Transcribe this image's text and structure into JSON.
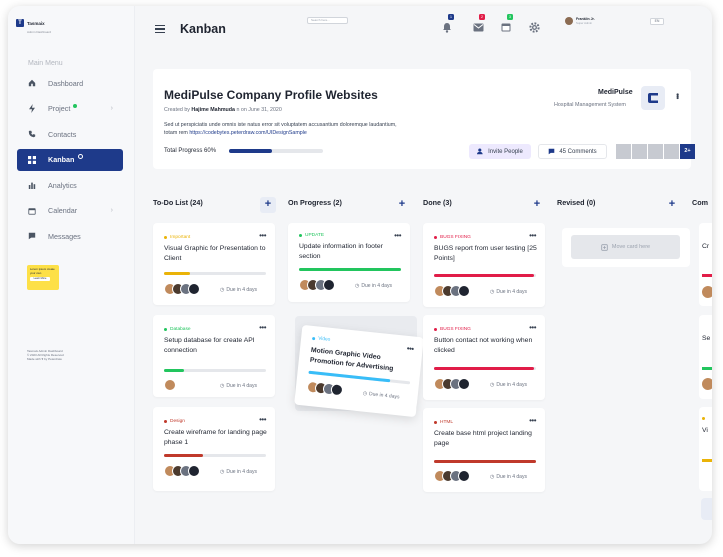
{
  "brand": {
    "name": "Tasmaix",
    "sub": "Admin Dashboard"
  },
  "sidebar": {
    "menu_title": "Main Menu",
    "items": [
      {
        "label": "Dashboard",
        "icon": "home-icon"
      },
      {
        "label": "Project",
        "icon": "bolt-icon"
      },
      {
        "label": "Contacts",
        "icon": "phone-icon"
      },
      {
        "label": "Kanban",
        "icon": "grid-icon"
      },
      {
        "label": "Analytics",
        "icon": "bar-chart-icon"
      },
      {
        "label": "Calendar",
        "icon": "calendar-icon"
      },
      {
        "label": "Messages",
        "icon": "message-icon"
      }
    ],
    "promo": {
      "text": "Lorem ipsum create your own",
      "button": "Learn More"
    },
    "footer": [
      "Tasmaix Admin Dashboard",
      "© 2023 All Rights Reserved",
      "Made with ♥ by Peterdraw"
    ]
  },
  "header": {
    "title": "Kanban",
    "search_placeholder": "Search here...",
    "badges": {
      "notifications": "1",
      "mail": "2",
      "calendar": "3"
    },
    "profile": {
      "name": "Franklin Jr.",
      "role": "Super Admin"
    },
    "lang": "EN"
  },
  "project": {
    "title": "MediPulse Company Profile Websites",
    "created_prefix": "Created by",
    "author": "Hajime Mahmuda",
    "created_suffix": "n on June 31, 2020",
    "description": "Sed ut perspiciatis unde omnis iste natus error sit voluptatem accusantium doloremque laudantium, totam rem",
    "link": "https://codebytes.peterdraw.com/UIDesignSample",
    "progress_label": "Total Progress 60%",
    "progress": 0.46,
    "client": "MediPulse",
    "client_sub": "Hospital Management System",
    "invite_label": "Invite People",
    "comments_label": "45 Comments",
    "team_more": "2+"
  },
  "columns": [
    {
      "title": "To-Do List (24)"
    },
    {
      "title": "On Progress (2)"
    },
    {
      "title": "Done (3)"
    },
    {
      "title": "Revised (0)"
    },
    {
      "title": "Com"
    }
  ],
  "cards": {
    "todo": [
      {
        "tag": "Important",
        "title": "Visual Graphic for Presentation to Client",
        "progress": 0.25,
        "due": "Due in 4 days"
      },
      {
        "tag": "Database",
        "title": "Setup database for create API connection",
        "progress": 0.2,
        "due": "Due in 4 days"
      },
      {
        "tag": "Design",
        "title": "Create wireframe for landing page phase 1",
        "progress": 0.38,
        "due": "Due in 4 days"
      }
    ],
    "progress": [
      {
        "tag": "UPDATE",
        "title": "Update information in footer section",
        "progress": 1.0,
        "due": "Due in 4 days"
      },
      {
        "tag": "Video",
        "title": "Motion Graphic Video Promotion for Advertising",
        "progress": 0.8,
        "due": "Due in 4 days"
      }
    ],
    "done": [
      {
        "tag": "BUGS FIXING",
        "title": "BUGS report from user testing [25 Points]",
        "progress": 0.98,
        "due": "Due in 4 days"
      },
      {
        "tag": "BUGS FIXING",
        "title": "Button contact not working when clicked",
        "progress": 0.98,
        "due": "Due in 4 days"
      },
      {
        "tag": "HTML",
        "title": "Create base html project landing page",
        "progress": 1.0,
        "due": "Due in 4 days"
      }
    ],
    "revised_placeholder": "Move card here",
    "completed_fragments": [
      {
        "title": "Cr"
      },
      {
        "title": "Se"
      },
      {
        "title": "Vi"
      }
    ]
  },
  "colors": {
    "accent": "#1e3a8a",
    "important": "#eab308",
    "database": "#22c55e",
    "design": "#c0392b",
    "update": "#22c55e",
    "video": "#38bdf8",
    "bugs": "#e11d48",
    "html": "#c0392b"
  }
}
